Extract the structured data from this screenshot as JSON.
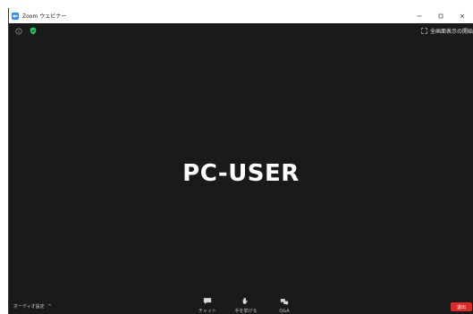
{
  "window": {
    "title": "Zoom ウェビナー"
  },
  "stage": {
    "fullscreen_label": "全画面表示の開始",
    "participant_name": "PC-USER"
  },
  "toolbar": {
    "audio_settings_label": "オーディオ設定",
    "audio_caret": "^",
    "chat_label": "チャット",
    "raise_hand_label": "手を挙げる",
    "qa_label": "Q&A",
    "leave_label": "退出"
  },
  "colors": {
    "background": "#1a1a1a",
    "accent": "#2d8cff",
    "shield": "#23c55e",
    "leave": "#e02828"
  }
}
